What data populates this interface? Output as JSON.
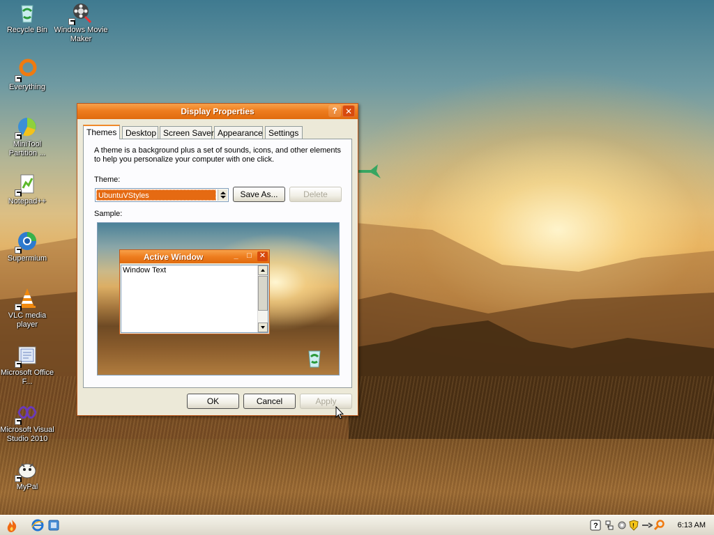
{
  "desktop": {
    "icons": [
      {
        "label": "Recycle Bin",
        "icon": "recycle-bin-icon"
      },
      {
        "label": "Windows Movie Maker",
        "icon": "movie-maker-icon"
      },
      {
        "label": "Everything",
        "icon": "everything-search-icon"
      },
      {
        "label": "MiniTool Partition ...",
        "icon": "minitool-partition-icon"
      },
      {
        "label": "Notepad++",
        "icon": "notepad-plus-plus-icon"
      },
      {
        "label": "Supermium",
        "icon": "supermium-browser-icon"
      },
      {
        "label": "VLC media player",
        "icon": "vlc-cone-icon"
      },
      {
        "label": "Microsoft Office F...",
        "icon": "office-file-icon"
      },
      {
        "label": "Microsoft Visual Studio 2010",
        "icon": "visual-studio-icon"
      },
      {
        "label": "MyPal",
        "icon": "mypal-browser-icon"
      }
    ]
  },
  "dialog": {
    "title": "Display Properties",
    "help_btn": "?",
    "close_btn": "✕",
    "tabs": [
      "Themes",
      "Desktop",
      "Screen Saver",
      "Appearance",
      "Settings"
    ],
    "active_tab": "Themes",
    "description": "A theme is a background plus a set of sounds, icons, and other elements to help you personalize your computer with one click.",
    "theme_label": "Theme:",
    "theme_value": "UbuntuVStyles",
    "save_as_label": "Save As...",
    "delete_label": "Delete",
    "sample_label": "Sample:",
    "sample": {
      "window_title": "Active Window",
      "window_text": "Window Text",
      "min_btn": "_",
      "max_btn": "□",
      "close_btn": "✕"
    },
    "ok_label": "OK",
    "cancel_label": "Cancel",
    "apply_label": "Apply"
  },
  "taskbar": {
    "start_icon": "start-flame-icon",
    "quick_launch": [
      "internet-explorer-icon",
      "show-desktop-icon"
    ],
    "tray_icons": [
      "help-icon",
      "network-icon",
      "settings-gear-icon",
      "security-shield-icon",
      "safely-remove-icon",
      "search-icon"
    ],
    "clock": "6:13 AM"
  },
  "colors": {
    "accent": "#ee7d1f",
    "dialog_bg": "#ece9d8",
    "selection": "#e56a12"
  }
}
